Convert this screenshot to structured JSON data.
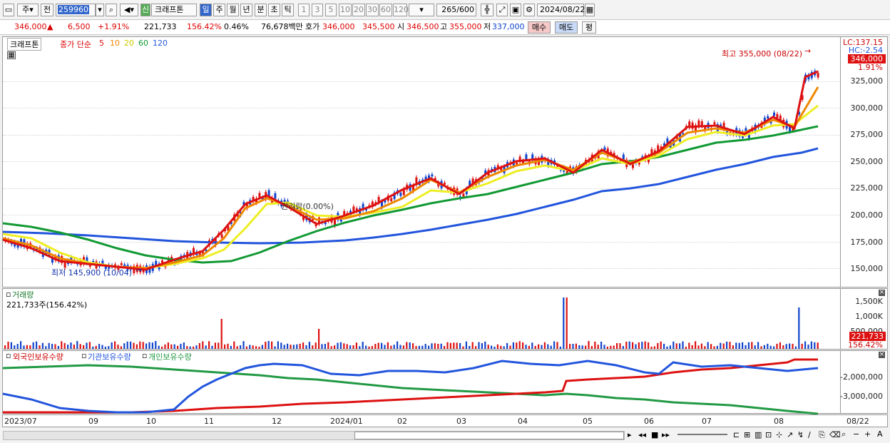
{
  "toolbar": {
    "market": "주",
    "prev": "전",
    "code": "259960",
    "stock_badge": "신",
    "stock_name": "크래프톤",
    "periods": [
      "일",
      "주",
      "월",
      "년",
      "분",
      "초",
      "틱"
    ],
    "multipliers": [
      "1",
      "3",
      "5",
      "10",
      "20",
      "30",
      "60",
      "120"
    ],
    "count": "265",
    "count_total": "/600",
    "date": "2024/08/22"
  },
  "info": {
    "price": "346,000",
    "change": "6,500",
    "rate": "+1.91%",
    "volume": "221,733",
    "vol_ratio": "156.42%",
    "turnover": "0.46%",
    "amount": "76,678백만",
    "ask_label": "호가",
    "ask1": "346,000",
    "ask2": "345,500",
    "open_label": "시",
    "open": "346,500",
    "high_label": "고",
    "high": "355,000",
    "low_label": "저",
    "low": "337,000",
    "buy": "매수",
    "sell": "매도",
    "avg": "평"
  },
  "price_panel": {
    "stock_label": "크래프톤",
    "ma_label": "종가 단순",
    "ma": [
      "5",
      "10",
      "20",
      "60",
      "120"
    ],
    "ma_colors": [
      "#dd1111",
      "#ee8800",
      "#eeee00",
      "#119933",
      "#2255dd"
    ],
    "lc": "LC:137.15",
    "hc": "HC:-2.54",
    "last_price": "346,000",
    "last_rate": "1.91%",
    "high_note": "최고 355,000 (08/22)",
    "low_note": "최저 145,900 (10/04)",
    "rights_note": "권리락(0.00%)",
    "y_labels": [
      "325,000",
      "300,000",
      "275,000",
      "250,000",
      "225,000",
      "200,000",
      "175,000",
      "150,000"
    ]
  },
  "volume_panel": {
    "title": "거래량",
    "value": "221,733주(156.42%)",
    "y_labels": [
      "1,500K",
      "1,000K",
      "500,000"
    ],
    "last": "221,733",
    "last_rate": "156.42%"
  },
  "holding_panel": {
    "legend": [
      "외국인보유수량",
      "기관보유수량",
      "개인보유수량"
    ],
    "y_labels": [
      "-2,000,000",
      "-3,000,000"
    ]
  },
  "x_labels": [
    "2023/07",
    "09",
    "10",
    "11",
    "12",
    "2024/01",
    "02",
    "03",
    "04",
    "05",
    "06",
    "07",
    "08",
    "08/22"
  ]
}
